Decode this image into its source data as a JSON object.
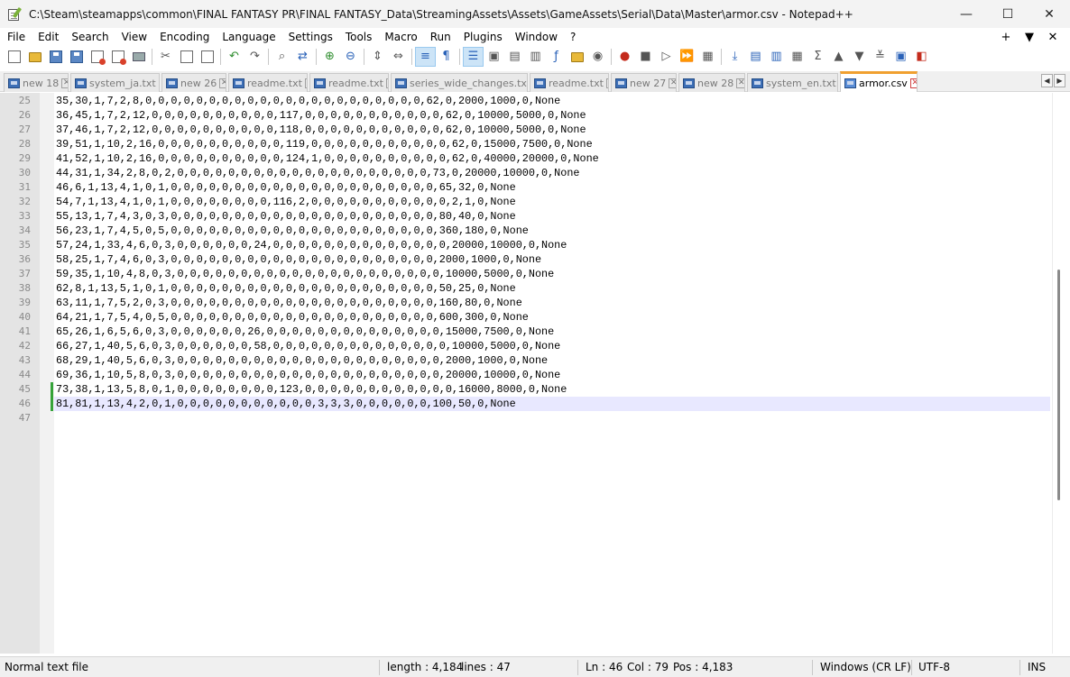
{
  "window": {
    "title": "C:\\Steam\\steamapps\\common\\FINAL FANTASY PR\\FINAL FANTASY_Data\\StreamingAssets\\Assets\\GameAssets\\Serial\\Data\\Master\\armor.csv - Notepad++",
    "minimize": "—",
    "maximize": "☐",
    "close": "✕"
  },
  "menu": {
    "items": [
      "File",
      "Edit",
      "Search",
      "View",
      "Encoding",
      "Language",
      "Settings",
      "Tools",
      "Macro",
      "Run",
      "Plugins",
      "Window",
      "?"
    ],
    "right": [
      "+",
      "▼",
      "✕"
    ]
  },
  "tabs": [
    {
      "label": "new 18",
      "active": false
    },
    {
      "label": "system_ja.txt",
      "active": false
    },
    {
      "label": "new 26",
      "active": false
    },
    {
      "label": "readme.txt",
      "active": false
    },
    {
      "label": "readme.txt",
      "active": false
    },
    {
      "label": "series_wide_changes.txt",
      "active": false
    },
    {
      "label": "readme.txt",
      "active": false
    },
    {
      "label": "new 27",
      "active": false
    },
    {
      "label": "new 28",
      "active": false
    },
    {
      "label": "system_en.txt",
      "active": false
    },
    {
      "label": "armor.csv",
      "active": true
    }
  ],
  "editor": {
    "lines": [
      {
        "n": "25",
        "text": "35,30,1,7,2,8,0,0,0,0,0,0,0,0,0,0,0,0,0,0,0,0,0,0,0,0,0,0,62,0,2000,1000,0,None"
      },
      {
        "n": "26",
        "text": "36,45,1,7,2,12,0,0,0,0,0,0,0,0,0,0,117,0,0,0,0,0,0,0,0,0,0,0,62,0,10000,5000,0,None"
      },
      {
        "n": "27",
        "text": "37,46,1,7,2,12,0,0,0,0,0,0,0,0,0,0,118,0,0,0,0,0,0,0,0,0,0,0,62,0,10000,5000,0,None"
      },
      {
        "n": "28",
        "text": "39,51,1,10,2,16,0,0,0,0,0,0,0,0,0,0,119,0,0,0,0,0,0,0,0,0,0,0,62,0,15000,7500,0,None"
      },
      {
        "n": "29",
        "text": "41,52,1,10,2,16,0,0,0,0,0,0,0,0,0,0,124,1,0,0,0,0,0,0,0,0,0,0,62,0,40000,20000,0,None"
      },
      {
        "n": "30",
        "text": "44,31,1,34,2,8,0,2,0,0,0,0,0,0,0,0,0,0,0,0,0,0,0,0,0,0,0,0,73,0,20000,10000,0,None"
      },
      {
        "n": "31",
        "text": "46,6,1,13,4,1,0,1,0,0,0,0,0,0,0,0,0,0,0,0,0,0,0,0,0,0,0,0,0,65,32,0,None"
      },
      {
        "n": "32",
        "text": "54,7,1,13,4,1,0,1,0,0,0,0,0,0,0,0,116,2,0,0,0,0,0,0,0,0,0,0,0,2,1,0,None"
      },
      {
        "n": "33",
        "text": "55,13,1,7,4,3,0,3,0,0,0,0,0,0,0,0,0,0,0,0,0,0,0,0,0,0,0,0,0,80,40,0,None"
      },
      {
        "n": "34",
        "text": "56,23,1,7,4,5,0,5,0,0,0,0,0,0,0,0,0,0,0,0,0,0,0,0,0,0,0,0,0,360,180,0,None"
      },
      {
        "n": "35",
        "text": "57,24,1,33,4,6,0,3,0,0,0,0,0,0,24,0,0,0,0,0,0,0,0,0,0,0,0,0,0,20000,10000,0,None"
      },
      {
        "n": "36",
        "text": "58,25,1,7,4,6,0,3,0,0,0,0,0,0,0,0,0,0,0,0,0,0,0,0,0,0,0,0,0,2000,1000,0,None"
      },
      {
        "n": "37",
        "text": "59,35,1,10,4,8,0,3,0,0,0,0,0,0,0,0,0,0,0,0,0,0,0,0,0,0,0,0,0,10000,5000,0,None"
      },
      {
        "n": "38",
        "text": "62,8,1,13,5,1,0,1,0,0,0,0,0,0,0,0,0,0,0,0,0,0,0,0,0,0,0,0,0,50,25,0,None"
      },
      {
        "n": "39",
        "text": "63,11,1,7,5,2,0,3,0,0,0,0,0,0,0,0,0,0,0,0,0,0,0,0,0,0,0,0,0,160,80,0,None"
      },
      {
        "n": "40",
        "text": "64,21,1,7,5,4,0,5,0,0,0,0,0,0,0,0,0,0,0,0,0,0,0,0,0,0,0,0,0,600,300,0,None"
      },
      {
        "n": "41",
        "text": "65,26,1,6,5,6,0,3,0,0,0,0,0,0,26,0,0,0,0,0,0,0,0,0,0,0,0,0,0,15000,7500,0,None"
      },
      {
        "n": "42",
        "text": "66,27,1,40,5,6,0,3,0,0,0,0,0,0,58,0,0,0,0,0,0,0,0,0,0,0,0,0,0,10000,5000,0,None"
      },
      {
        "n": "43",
        "text": "68,29,1,40,5,6,0,3,0,0,0,0,0,0,0,0,0,0,0,0,0,0,0,0,0,0,0,0,0,2000,1000,0,None"
      },
      {
        "n": "44",
        "text": "69,36,1,10,5,8,0,3,0,0,0,0,0,0,0,0,0,0,0,0,0,0,0,0,0,0,0,0,0,20000,10000,0,None"
      },
      {
        "n": "45",
        "text": "73,38,1,13,5,8,0,1,0,0,0,0,0,0,0,0,123,0,0,0,0,0,0,0,0,0,0,0,0,16000,8000,0,None"
      },
      {
        "n": "46",
        "text": "81,81,1,13,4,2,0,1,0,0,0,0,0,0,0,0,0,0,0,3,3,3,0,0,0,0,0,0,100,50,0,None"
      },
      {
        "n": "47",
        "text": ""
      }
    ]
  },
  "status": {
    "filetype": "Normal text file",
    "length": "length : 4,184",
    "lines": "lines : 47",
    "ln": "Ln : 46",
    "col": "Col : 79",
    "pos": "Pos : 4,183",
    "eol": "Windows (CR LF)",
    "encoding": "UTF-8",
    "mode": "INS"
  },
  "colors": {
    "active_tab_accent": "#f0a030",
    "current_line": "#e8e8ff",
    "change_marker": "#36a33a"
  }
}
